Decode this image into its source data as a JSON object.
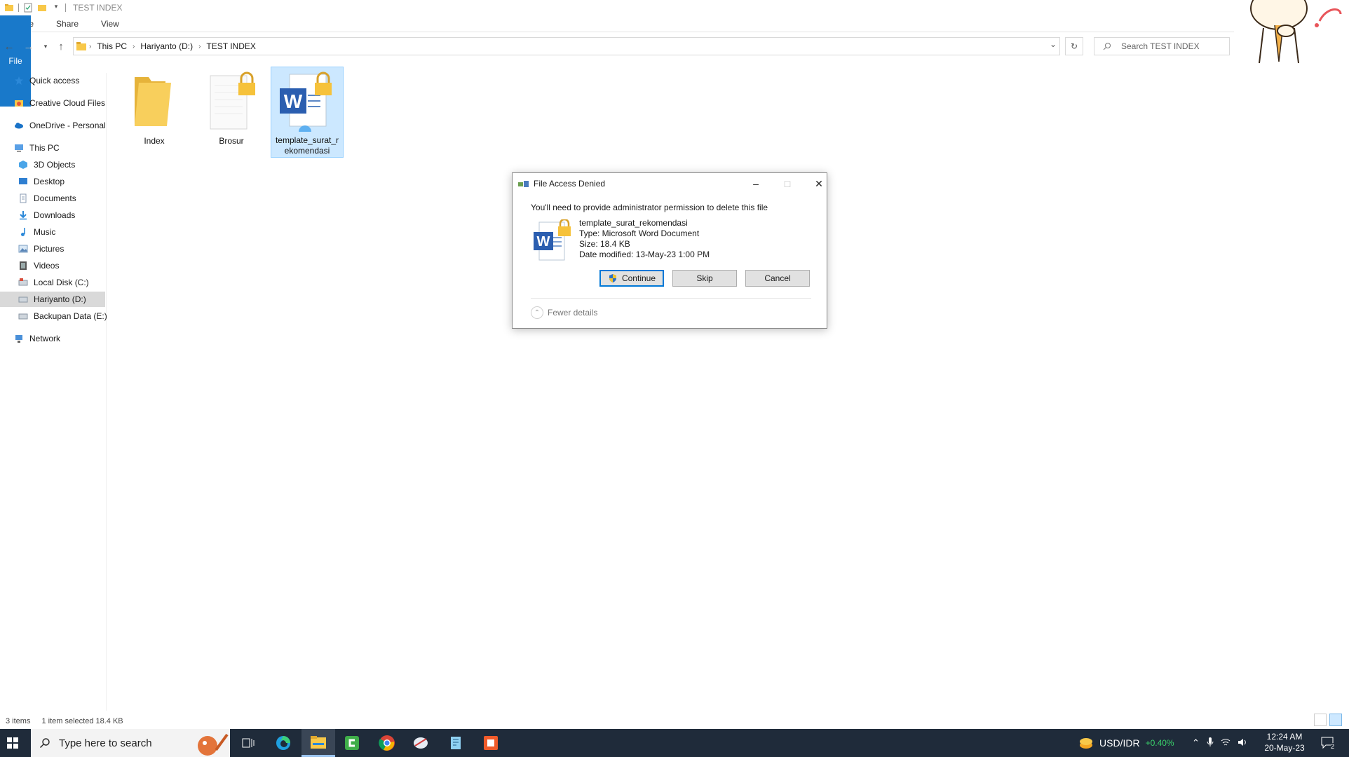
{
  "window": {
    "title": "TEST INDEX"
  },
  "ribbon": {
    "tabs": [
      "File",
      "Home",
      "Share",
      "View"
    ]
  },
  "address": {
    "crumbs": [
      "This PC",
      "Hariyanto (D:)",
      "TEST INDEX"
    ],
    "search_placeholder": "Search TEST INDEX"
  },
  "sidebar": {
    "items": [
      {
        "label": "Quick access",
        "icon": "star-icon"
      },
      {
        "label": "Creative Cloud Files",
        "icon": "creative-cloud-icon"
      },
      {
        "label": "OneDrive - Personal",
        "icon": "onedrive-cloud-icon"
      },
      {
        "label": "This PC",
        "icon": "computer-icon"
      },
      {
        "label": "3D Objects",
        "icon": "cube-icon"
      },
      {
        "label": "Desktop",
        "icon": "desktop-icon"
      },
      {
        "label": "Documents",
        "icon": "document-icon"
      },
      {
        "label": "Downloads",
        "icon": "download-arrow-icon"
      },
      {
        "label": "Music",
        "icon": "music-note-icon"
      },
      {
        "label": "Pictures",
        "icon": "picture-icon"
      },
      {
        "label": "Videos",
        "icon": "film-icon"
      },
      {
        "label": "Local Disk (C:)",
        "icon": "drive-icon"
      },
      {
        "label": "Hariyanto (D:)",
        "icon": "drive-icon"
      },
      {
        "label": "Backupan Data (E:)",
        "icon": "drive-icon"
      },
      {
        "label": "Network",
        "icon": "network-icon"
      }
    ]
  },
  "files": [
    {
      "label_line1": "Index",
      "label_line2": "",
      "type": "folder"
    },
    {
      "label_line1": "Brosur",
      "label_line2": "",
      "type": "locked-document"
    },
    {
      "label_line1": "template_surat_r",
      "label_line2": "ekomendasi",
      "type": "locked-word-document"
    }
  ],
  "dialog": {
    "title": "File Access Denied",
    "message": "You'll need to provide administrator permission to delete this file",
    "file_name": "template_surat_rekomendasi",
    "file_type": "Type: Microsoft Word Document",
    "file_size": "Size: 18.4 KB",
    "file_modified": "Date modified: 13-May-23 1:00 PM",
    "continue_label": "Continue",
    "skip_label": "Skip",
    "cancel_label": "Cancel",
    "fewer_details": "Fewer details"
  },
  "status": {
    "items_count": "3 items",
    "selection": "1 item selected  18.4 KB"
  },
  "taskbar": {
    "search_placeholder": "Type here to search",
    "ticker_symbol": "USD/IDR",
    "ticker_change": "+0.40%",
    "clock_time": "12:24 AM",
    "clock_date": "20-May-23",
    "notification_count": "2"
  },
  "colors": {
    "accent": "#1979ca",
    "selection": "#cce8ff",
    "taskbar": "#1f2b3a",
    "ticker_up": "#3ad36b"
  }
}
